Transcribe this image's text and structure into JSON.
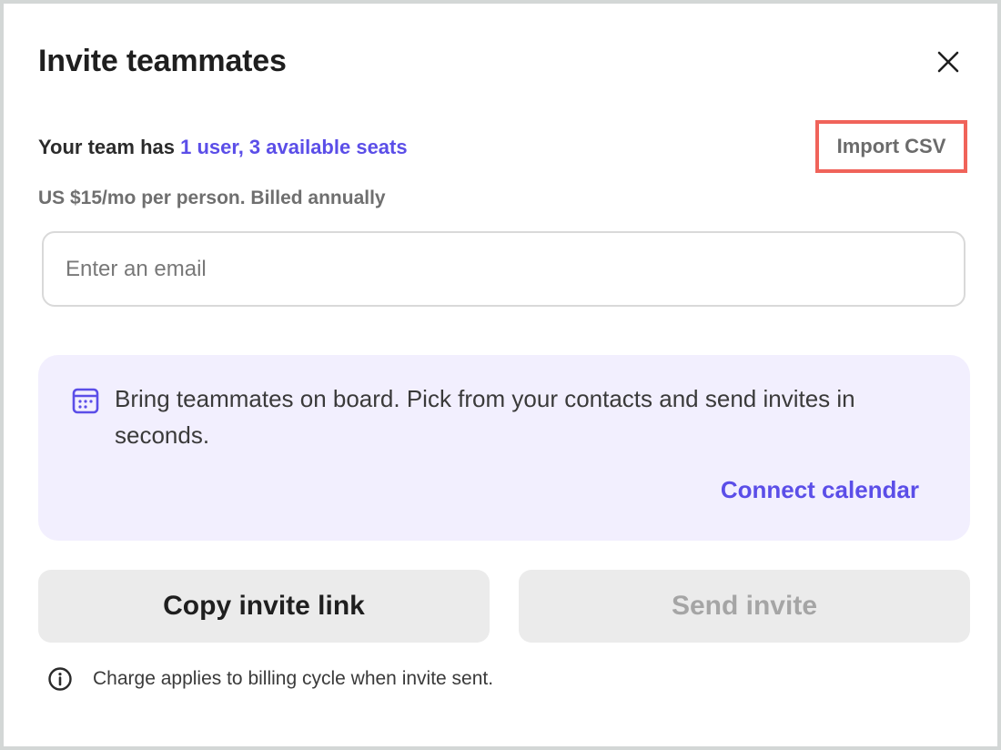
{
  "dialog": {
    "title": "Invite teammates",
    "close_icon": "close-icon"
  },
  "seats": {
    "prefix": "Your team has ",
    "link": "1 user, 3 available seats"
  },
  "import_csv_label": "Import CSV",
  "pricing": "US $15/mo per person. Billed annually",
  "email": {
    "value": "",
    "placeholder": "Enter an email"
  },
  "promo": {
    "icon": "calendar-icon",
    "text": "Bring teammates on board. Pick from your contacts and send invites in seconds.",
    "link": "Connect calendar"
  },
  "actions": {
    "copy_label": "Copy invite link",
    "send_label": "Send invite"
  },
  "footnote": {
    "icon": "info-icon",
    "text": "Charge applies to billing cycle when invite sent."
  },
  "colors": {
    "accent": "#5b4ee8",
    "promo_bg": "#f2effe",
    "highlight_border": "#f0635a",
    "button_bg": "#ebebeb",
    "disabled_text": "#a5a5a5"
  }
}
